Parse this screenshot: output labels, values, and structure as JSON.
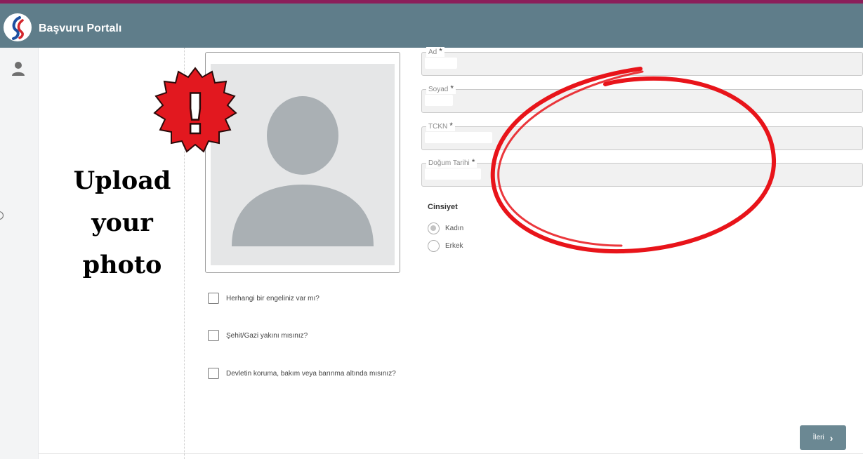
{
  "header": {
    "title": "Başvuru Portalı"
  },
  "overlay": {
    "badge_symbol": "!",
    "upload_lines": [
      "Upload",
      "your",
      "photo"
    ]
  },
  "form": {
    "fields": [
      {
        "label": "Ad",
        "required_mark": "*"
      },
      {
        "label": "Soyad",
        "required_mark": "*"
      },
      {
        "label": "TCKN",
        "required_mark": "*"
      },
      {
        "label": "Doğum Tarihi",
        "required_mark": "*"
      }
    ],
    "gender": {
      "title": "Cinsiyet",
      "options": [
        {
          "label": "Kadın",
          "selected": true
        },
        {
          "label": "Erkek",
          "selected": false
        }
      ]
    },
    "checkboxes": [
      {
        "label": "Herhangi bir engeliniz var mı?",
        "checked": false
      },
      {
        "label": "Şehit/Gazi yakını mısınız?",
        "checked": false
      },
      {
        "label": "Devletin koruma, bakım veya barınma altında mısınız?",
        "checked": false
      }
    ],
    "next_button": {
      "label": "İleri",
      "icon": "chevron-right-icon"
    }
  },
  "colors": {
    "header_bg": "#5f7d8a",
    "top_strip": "#8b1e5a",
    "badge_red": "#e2181f",
    "annotation_red": "#e8141a",
    "button_bg": "#6b8893"
  }
}
